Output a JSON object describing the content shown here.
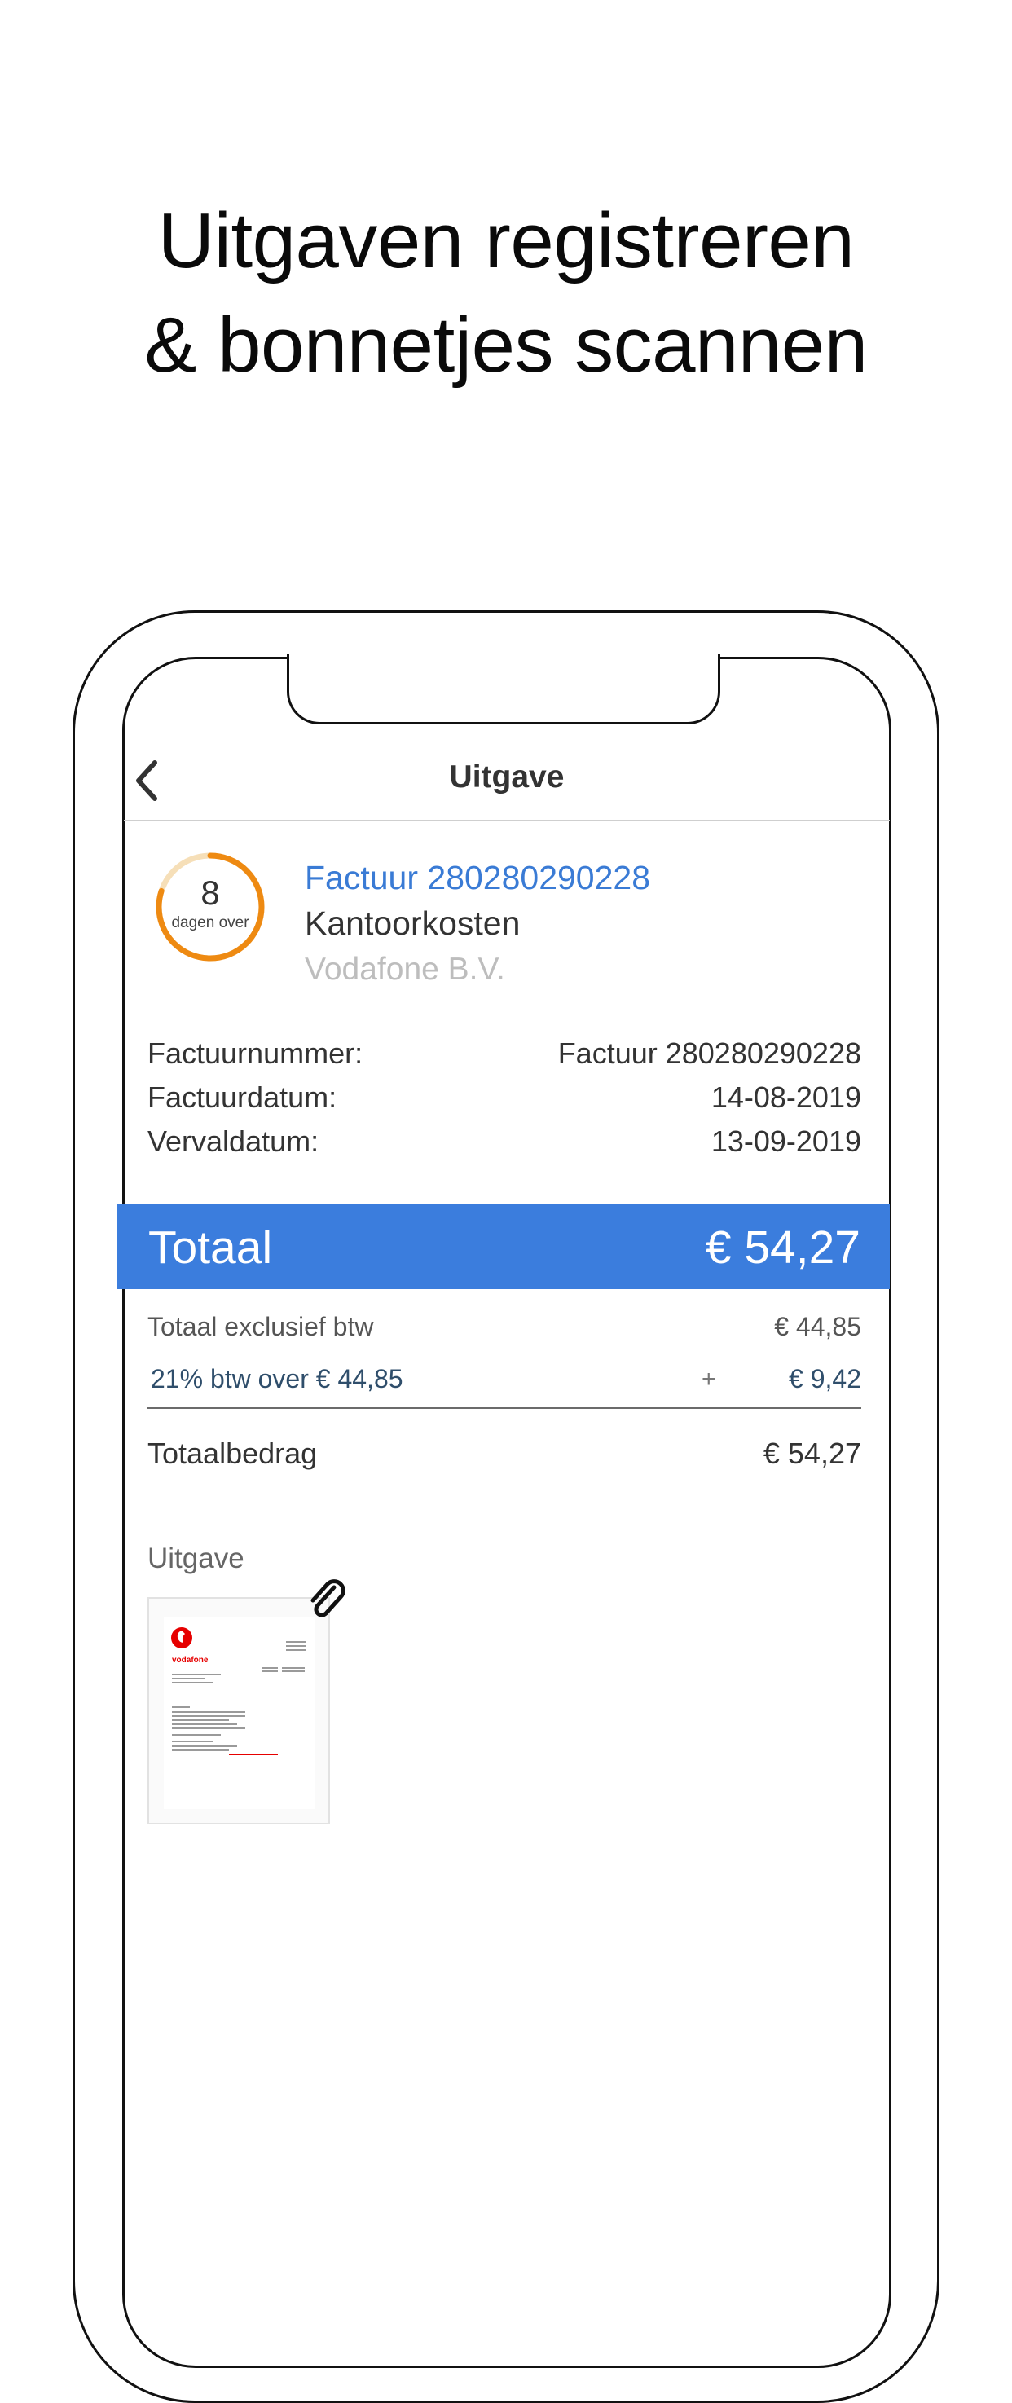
{
  "headline": {
    "line1": "Uitgaven registreren",
    "line2": "& bonnetjes scannen"
  },
  "nav": {
    "title": "Uitgave",
    "back_icon": "chevron-left-icon"
  },
  "invoice": {
    "days_left": "8",
    "days_label": "dagen over",
    "days_progress_fraction": 0.8,
    "link_text": "Factuur 280280290228",
    "category": "Kantoorkosten",
    "vendor": "Vodafone B.V."
  },
  "details": [
    {
      "label": "Factuurnummer:",
      "value": "Factuur 280280290228"
    },
    {
      "label": "Factuurdatum:",
      "value": "14-08-2019"
    },
    {
      "label": "Vervaldatum:",
      "value": "13-09-2019"
    }
  ],
  "total": {
    "label": "Totaal",
    "value": "€ 54,27"
  },
  "breakdown": {
    "excl_label": "Totaal exclusief btw",
    "excl_value": "€ 44,85",
    "btw_label": "21% btw over € 44,85",
    "btw_sign": "+",
    "btw_value": "€ 9,42",
    "grand_label": "Totaalbedrag",
    "grand_value": "€ 54,27"
  },
  "attachment": {
    "section_label": "Uitgave",
    "logo_text": "vodafone",
    "clip_icon": "paperclip-icon"
  },
  "colors": {
    "accent": "#3b7ddd",
    "link": "#3a7bd5",
    "countdown_ring": "#ee8a12",
    "countdown_track": "#f6dfb8",
    "vodafone_red": "#e60000"
  }
}
